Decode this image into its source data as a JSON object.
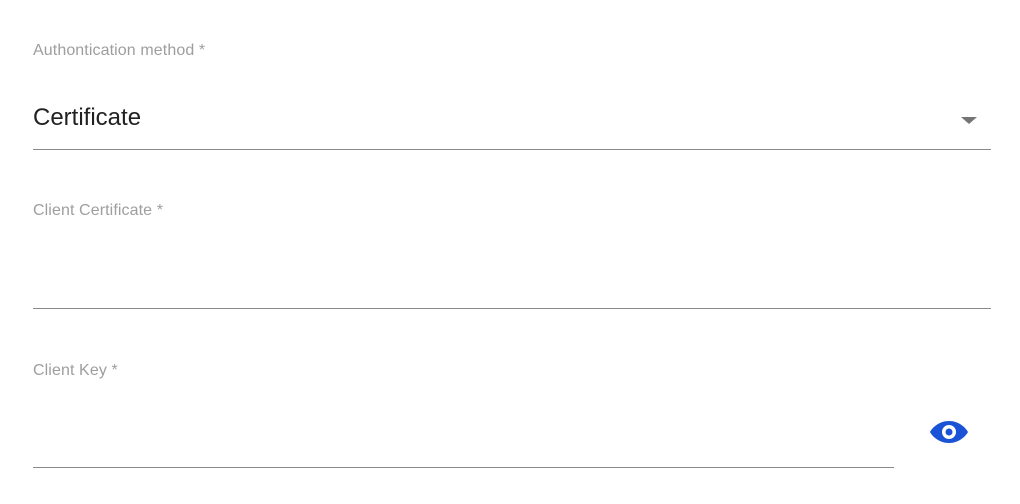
{
  "auth_method": {
    "label": "Authontication method *",
    "selected_value": "Certificate",
    "icon": "chevron-down-icon"
  },
  "client_certificate": {
    "label": "Client Certificate *",
    "value": ""
  },
  "client_key": {
    "label": "Client Key *",
    "value": "",
    "toggle_icon": "eye-icon",
    "toggle_color": "#1a53d6"
  },
  "colors": {
    "label": "#9e9e9e",
    "text": "#212121",
    "underline": "#8a8a8a",
    "accent": "#1a53d6"
  }
}
